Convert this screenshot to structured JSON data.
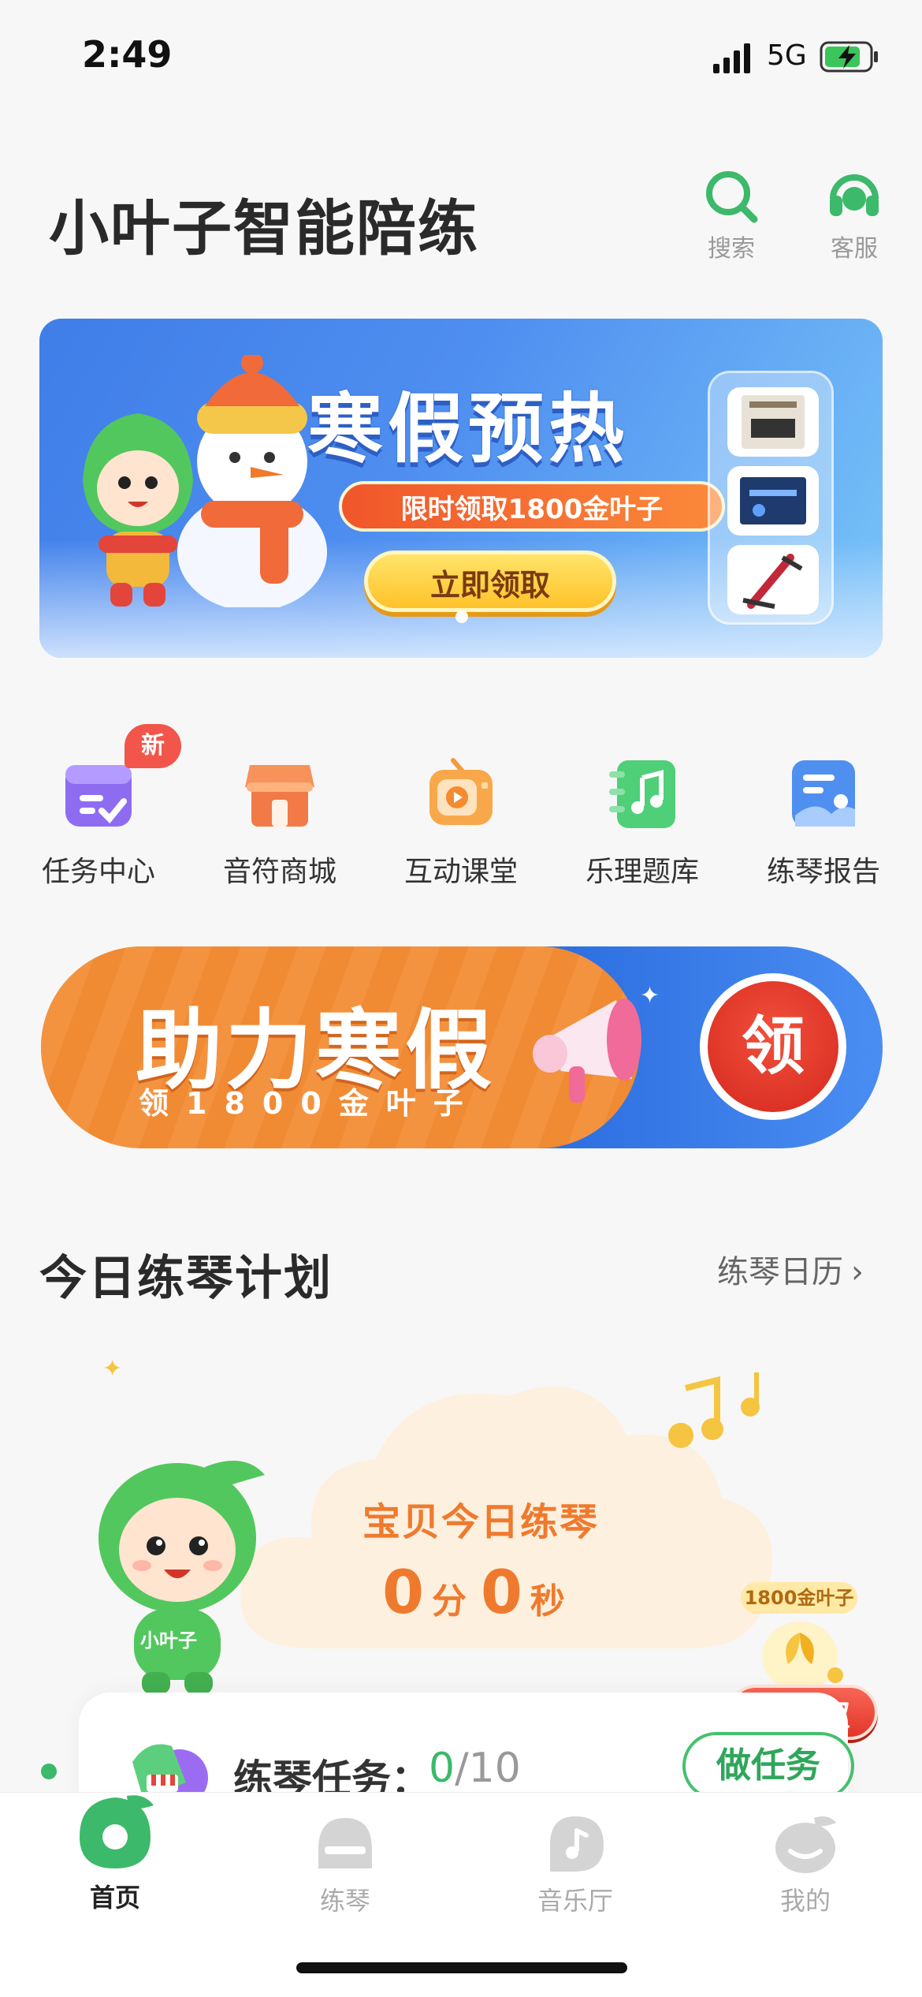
{
  "status_bar": {
    "time": "2:49",
    "network": "5G"
  },
  "header": {
    "title": "小叶子智能陪练",
    "search_label": "搜索",
    "service_label": "客服"
  },
  "banner": {
    "title": "寒假预热",
    "subtitle": "限时领取1800金叶子",
    "cta": "立即领取"
  },
  "quick_menu": {
    "items": [
      {
        "label": "任务中心",
        "badge": "新",
        "icon": "task-calendar-icon"
      },
      {
        "label": "音符商城",
        "icon": "shop-icon"
      },
      {
        "label": "互动课堂",
        "icon": "tv-icon"
      },
      {
        "label": "乐理题库",
        "icon": "music-book-icon"
      },
      {
        "label": "练琴报告",
        "icon": "report-icon"
      }
    ]
  },
  "promo": {
    "title": "助力寒假",
    "subtitle": "领1800金叶子",
    "claim": "领"
  },
  "plan": {
    "title": "今日练琴计划",
    "calendar_link": "练琴日历",
    "today_label": "宝贝今日练琴",
    "minutes": "0",
    "minutes_unit": "分",
    "seconds": "0",
    "seconds_unit": "秒",
    "mascot_label": "小叶子"
  },
  "reward": {
    "amount_label": "1800金叶子",
    "button": "待领取"
  },
  "task": {
    "label": "练琴任务：",
    "done": "0",
    "total": "/10",
    "button": "做任务"
  },
  "tab_bar": {
    "tabs": [
      {
        "label": "首页",
        "active": true
      },
      {
        "label": "练琴"
      },
      {
        "label": "音乐厅"
      },
      {
        "label": "我的"
      }
    ]
  },
  "colors": {
    "brand_green": "#3cb96a",
    "accent_orange": "#ef7a2e",
    "banner_blue": "#4f8ff0",
    "claim_red": "#e4372a"
  }
}
